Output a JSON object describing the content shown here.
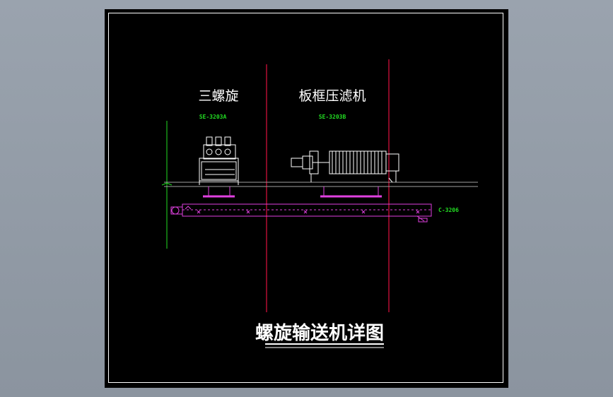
{
  "drawing": {
    "label_three_screw": "三螺旋",
    "label_filter_press": "板框压滤机",
    "tag_three_screw": "SE-3203A",
    "tag_filter_press": "SE-3203B",
    "tag_conveyor": "C-3206",
    "title": "螺旋输送机详图"
  },
  "colors": {
    "background": "#8f98a3",
    "sheet": "#000000",
    "frame": "#ffffff",
    "section_line": "#e01040",
    "conveyor": "#e040e0",
    "equipment": "#ffffff",
    "dimension": "#22dd22"
  }
}
